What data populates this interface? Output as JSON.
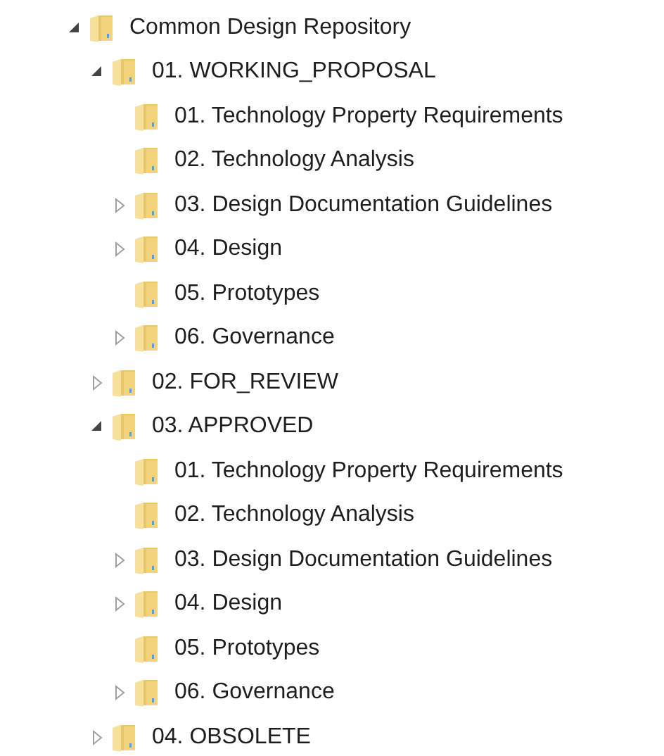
{
  "tree": [
    {
      "label": "Common Design Repository",
      "kind": "expanded",
      "children": [
        {
          "label": "01. WORKING_PROPOSAL",
          "kind": "expanded",
          "children": [
            {
              "label": "01. Technology Property Requirements",
              "kind": "leaf"
            },
            {
              "label": "02. Technology Analysis",
              "kind": "leaf"
            },
            {
              "label": "03. Design Documentation Guidelines",
              "kind": "collapsed"
            },
            {
              "label": "04. Design",
              "kind": "collapsed"
            },
            {
              "label": "05. Prototypes",
              "kind": "leaf"
            },
            {
              "label": "06. Governance",
              "kind": "collapsed"
            }
          ]
        },
        {
          "label": "02. FOR_REVIEW",
          "kind": "collapsed"
        },
        {
          "label": "03. APPROVED",
          "kind": "expanded",
          "children": [
            {
              "label": "01. Technology Property Requirements",
              "kind": "leaf"
            },
            {
              "label": "02. Technology Analysis",
              "kind": "leaf"
            },
            {
              "label": "03. Design Documentation Guidelines",
              "kind": "collapsed"
            },
            {
              "label": "04. Design",
              "kind": "collapsed"
            },
            {
              "label": "05. Prototypes",
              "kind": "leaf"
            },
            {
              "label": "06. Governance",
              "kind": "collapsed"
            }
          ]
        },
        {
          "label": "04. OBSOLETE",
          "kind": "collapsed"
        }
      ]
    }
  ]
}
